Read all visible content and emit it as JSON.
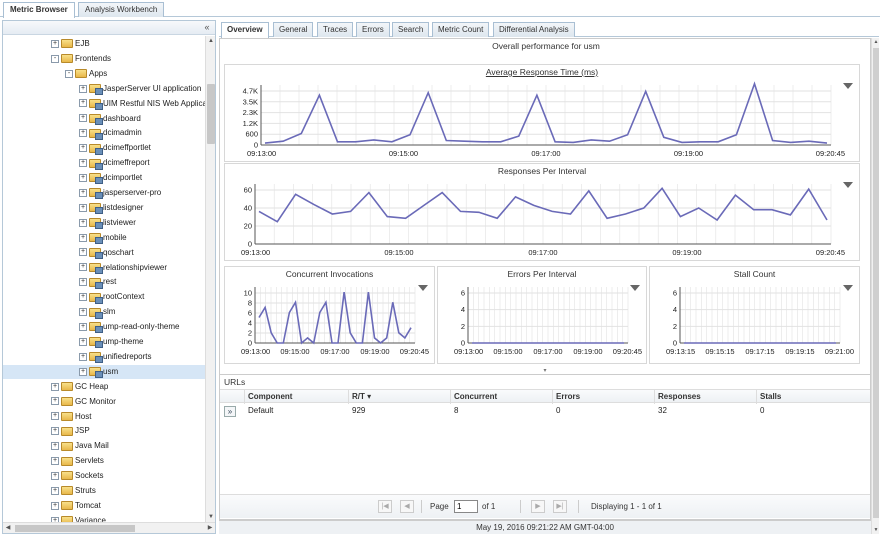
{
  "top_tabs": [
    "Metric Browser",
    "Analysis Workbench"
  ],
  "tree": {
    "items": [
      {
        "label": "EJB",
        "indent": 1,
        "kind": "folder",
        "exp": "+"
      },
      {
        "label": "Frontends",
        "indent": 1,
        "kind": "folder",
        "exp": "-"
      },
      {
        "label": "Apps",
        "indent": 2,
        "kind": "folder",
        "exp": "-"
      },
      {
        "label": "JasperServer UI application",
        "indent": 3,
        "kind": "res",
        "exp": "+"
      },
      {
        "label": "UIM Restful NIS Web Applicati",
        "indent": 3,
        "kind": "res",
        "exp": "+"
      },
      {
        "label": "dashboard",
        "indent": 3,
        "kind": "res",
        "exp": "+"
      },
      {
        "label": "dcimadmin",
        "indent": 3,
        "kind": "res",
        "exp": "+"
      },
      {
        "label": "dcimeffportlet",
        "indent": 3,
        "kind": "res",
        "exp": "+"
      },
      {
        "label": "dcimeffreport",
        "indent": 3,
        "kind": "res",
        "exp": "+"
      },
      {
        "label": "dcimportlet",
        "indent": 3,
        "kind": "res",
        "exp": "+"
      },
      {
        "label": "jasperserver-pro",
        "indent": 3,
        "kind": "res",
        "exp": "+"
      },
      {
        "label": "listdesigner",
        "indent": 3,
        "kind": "res",
        "exp": "+"
      },
      {
        "label": "listviewer",
        "indent": 3,
        "kind": "res",
        "exp": "+"
      },
      {
        "label": "mobile",
        "indent": 3,
        "kind": "res",
        "exp": "+"
      },
      {
        "label": "qoschart",
        "indent": 3,
        "kind": "res",
        "exp": "+"
      },
      {
        "label": "relationshipviewer",
        "indent": 3,
        "kind": "res",
        "exp": "+"
      },
      {
        "label": "rest",
        "indent": 3,
        "kind": "res",
        "exp": "+"
      },
      {
        "label": "rootContext",
        "indent": 3,
        "kind": "res",
        "exp": "+"
      },
      {
        "label": "slm",
        "indent": 3,
        "kind": "res",
        "exp": "+"
      },
      {
        "label": "ump-read-only-theme",
        "indent": 3,
        "kind": "res",
        "exp": "+"
      },
      {
        "label": "ump-theme",
        "indent": 3,
        "kind": "res",
        "exp": "+"
      },
      {
        "label": "unifiedreports",
        "indent": 3,
        "kind": "res",
        "exp": "+"
      },
      {
        "label": "usm",
        "indent": 3,
        "kind": "res",
        "exp": "+",
        "selected": true
      },
      {
        "label": "GC Heap",
        "indent": 1,
        "kind": "folder",
        "exp": "+"
      },
      {
        "label": "GC Monitor",
        "indent": 1,
        "kind": "folder",
        "exp": "+"
      },
      {
        "label": "Host",
        "indent": 1,
        "kind": "folder",
        "exp": "+"
      },
      {
        "label": "JSP",
        "indent": 1,
        "kind": "folder",
        "exp": "+"
      },
      {
        "label": "Java Mail",
        "indent": 1,
        "kind": "folder",
        "exp": "+"
      },
      {
        "label": "Servlets",
        "indent": 1,
        "kind": "folder",
        "exp": "+"
      },
      {
        "label": "Sockets",
        "indent": 1,
        "kind": "folder",
        "exp": "+"
      },
      {
        "label": "Struts",
        "indent": 1,
        "kind": "folder",
        "exp": "+"
      },
      {
        "label": "Tomcat",
        "indent": 1,
        "kind": "folder",
        "exp": "+"
      },
      {
        "label": "Variance",
        "indent": 1,
        "kind": "folder",
        "exp": "+"
      }
    ]
  },
  "sub_tabs": [
    "Overview",
    "General",
    "Traces",
    "Errors",
    "Search",
    "Metric Count",
    "Differential Analysis"
  ],
  "overview_title": "Overall performance for usm",
  "colors": {
    "line": "#6a6ab8",
    "grid": "#e2e2e2"
  },
  "chart_data": [
    {
      "type": "line",
      "title": "Average Response Time (ms)",
      "x_tick_labels": [
        "09:13:00",
        "09:15:00",
        "09:17:00",
        "09:19:00",
        "09:20:45"
      ],
      "y_tick_labels": [
        "0",
        "600",
        "1.2K",
        "2.3K",
        "3.5K",
        "4.7K"
      ],
      "ylim": [
        0,
        4700
      ],
      "values": [
        150,
        300,
        900,
        3900,
        250,
        250,
        400,
        250,
        800,
        4100,
        350,
        300,
        250,
        250,
        700,
        3900,
        250,
        200,
        400,
        300,
        800,
        4200,
        600,
        200,
        250,
        250,
        800,
        4800,
        350,
        200,
        300,
        150
      ]
    },
    {
      "type": "line",
      "title": "Responses Per Interval",
      "x_tick_labels": [
        "09:13:00",
        "09:15:00",
        "09:17:00",
        "09:19:00",
        "09:20:45"
      ],
      "y_tick_labels": [
        "0",
        "20",
        "40",
        "60"
      ],
      "ylim": [
        0,
        70
      ],
      "values": [
        38,
        26,
        58,
        46,
        35,
        38,
        60,
        32,
        30,
        45,
        60,
        38,
        37,
        30,
        55,
        45,
        38,
        35,
        62,
        30,
        35,
        42,
        65,
        32,
        42,
        28,
        57,
        40,
        40,
        34,
        64,
        28
      ]
    },
    {
      "type": "line",
      "title": "Concurrent Invocations",
      "x_tick_labels": [
        "09:13:00",
        "09:15:00",
        "09:17:00",
        "09:19:00",
        "09:20:45"
      ],
      "y_tick_labels": [
        "0",
        "2",
        "4",
        "6",
        "8",
        "10"
      ],
      "ylim": [
        0,
        11
      ],
      "values": [
        5,
        7,
        2,
        0,
        0,
        6,
        8,
        0,
        1,
        0,
        6,
        8,
        0,
        0,
        10,
        2,
        0,
        0,
        10,
        1,
        0,
        1,
        8,
        2,
        1,
        3
      ]
    },
    {
      "type": "line",
      "title": "Errors Per Interval",
      "x_tick_labels": [
        "09:13:00",
        "09:15:00",
        "09:17:00",
        "09:19:00",
        "09:20:45"
      ],
      "y_tick_labels": [
        "0",
        "2",
        "4",
        "6"
      ],
      "ylim": [
        0,
        6
      ],
      "values": [
        0,
        0,
        0,
        0,
        0,
        0,
        0,
        0,
        0,
        0,
        0,
        0
      ]
    },
    {
      "type": "line",
      "title": "Stall Count",
      "x_tick_labels": [
        "09:13:15",
        "09:15:15",
        "09:17:15",
        "09:19:15",
        "09:21:00"
      ],
      "y_tick_labels": [
        "0",
        "2",
        "4",
        "6"
      ],
      "ylim": [
        0,
        6
      ],
      "values": [
        0,
        0,
        0,
        0,
        0,
        0,
        0,
        0,
        0,
        0,
        0,
        0
      ]
    }
  ],
  "urls": {
    "title": "URLs",
    "columns": [
      "Component",
      "R/T ▾",
      "Concurrent",
      "Errors",
      "Responses",
      "Stalls"
    ],
    "rows": [
      [
        "Default",
        "929",
        "8",
        "0",
        "32",
        "0"
      ]
    ],
    "drill_icon": "»"
  },
  "pager": {
    "page_label": "Page",
    "page_value": "1",
    "of_label": "of 1",
    "display_text": "Displaying 1 - 1 of 1",
    "first_icon": "|◀",
    "prev_icon": "◀",
    "next_icon": "▶",
    "last_icon": "▶|"
  },
  "status": "May 19, 2016 09:21:22 AM GMT-04:00"
}
